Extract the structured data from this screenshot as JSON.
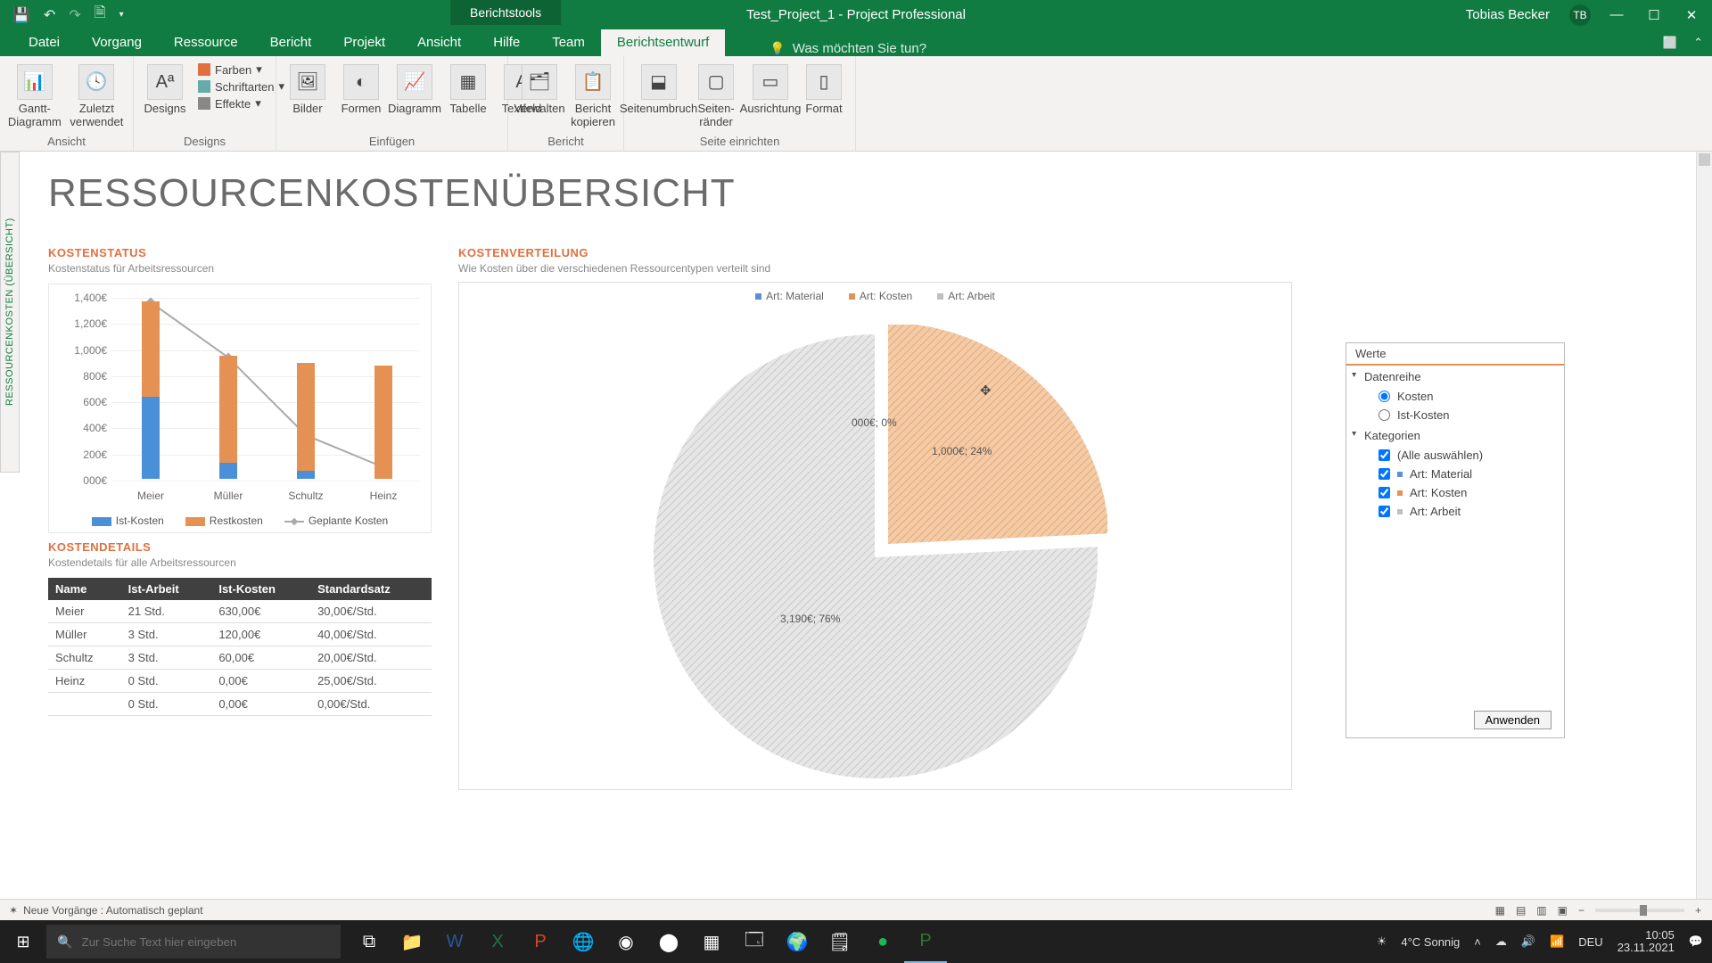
{
  "titlebar": {
    "tool_tab": "Berichtstools",
    "doc_title": "Test_Project_1  -  Project Professional",
    "user_name": "Tobias Becker",
    "user_initials": "TB"
  },
  "tabs": [
    "Datei",
    "Vorgang",
    "Ressource",
    "Bericht",
    "Projekt",
    "Ansicht",
    "Hilfe",
    "Team",
    "Berichtsentwurf"
  ],
  "active_tab": "Berichtsentwurf",
  "tellme": "Was möchten Sie tun?",
  "ribbon": {
    "groups": {
      "ansicht": {
        "label": "Ansicht",
        "gantt": "Gantt-Diagramm",
        "zuletzt": "Zuletzt verwendet"
      },
      "designs": {
        "label": "Designs",
        "designs_btn": "Designs",
        "farben": "Farben",
        "schrift": "Schriftarten",
        "effekte": "Effekte"
      },
      "einfuegen": {
        "label": "Einfügen",
        "bilder": "Bilder",
        "formen": "Formen",
        "diagramm": "Diagramm",
        "tabelle": "Tabelle",
        "textfeld": "Textfeld"
      },
      "bericht": {
        "label": "Bericht",
        "verwalten": "Verwalten",
        "kopieren": "Bericht kopieren"
      },
      "seite": {
        "label": "Seite einrichten",
        "umbruch": "Seitenumbruch",
        "raender": "Seiten-ränder",
        "ausricht": "Ausrichtung",
        "format": "Format"
      }
    }
  },
  "vtab": "RESSOURCENKOSTEN (ÜBERSICHT)",
  "report": {
    "title": "RESSOURCENKOSTENÜBERSICHT",
    "status": {
      "hd": "KOSTENSTATUS",
      "sub": "Kostenstatus für Arbeitsressourcen"
    },
    "vert": {
      "hd": "KOSTENVERTEILUNG",
      "sub": "Wie Kosten über die verschiedenen Ressourcentypen verteilt sind"
    },
    "details": {
      "hd": "KOSTENDETAILS",
      "sub": "Kostendetails für alle Arbeitsressourcen"
    }
  },
  "status_legend": {
    "ist": "Ist-Kosten",
    "rest": "Restkosten",
    "geplant": "Geplante Kosten"
  },
  "pie_legend": {
    "material": "Art: Material",
    "kosten": "Art: Kosten",
    "arbeit": "Art: Arbeit"
  },
  "pie_labels": {
    "material": "000€; 0%",
    "kosten": "1,000€; 24%",
    "arbeit": "3,190€; 76%"
  },
  "combo_ylabels": [
    "000€",
    "200€",
    "400€",
    "600€",
    "800€",
    "1,000€",
    "1,200€",
    "1,400€"
  ],
  "table": {
    "headers": [
      "Name",
      "Ist-Arbeit",
      "Ist-Kosten",
      "Standardsatz"
    ],
    "rows": [
      [
        "Meier",
        "21 Std.",
        "630,00€",
        "30,00€/Std."
      ],
      [
        "Müller",
        "3 Std.",
        "120,00€",
        "40,00€/Std."
      ],
      [
        "Schultz",
        "3 Std.",
        "60,00€",
        "20,00€/Std."
      ],
      [
        "Heinz",
        "0 Std.",
        "0,00€",
        "25,00€/Std."
      ],
      [
        "",
        "0 Std.",
        "0,00€",
        "0,00€/Std."
      ]
    ]
  },
  "werte": {
    "title": "Werte",
    "datenreihe": "Datenreihe",
    "kosten": "Kosten",
    "ist": "Ist-Kosten",
    "kategorien": "Kategorien",
    "alle": "(Alle auswählen)",
    "cat_material": "Art: Material",
    "cat_kosten": "Art: Kosten",
    "cat_arbeit": "Art: Arbeit",
    "apply": "Anwenden"
  },
  "status_text": "Neue Vorgänge : Automatisch geplant",
  "taskbar": {
    "search_placeholder": "Zur Suche Text hier eingeben",
    "weather": "4°C  Sonnig",
    "lang": "DEU",
    "time": "10:05",
    "date": "23.11.2021"
  },
  "chart_data": [
    {
      "type": "bar",
      "name": "Kostenstatus",
      "categories": [
        "Meier",
        "Müller",
        "Schultz",
        "Heinz"
      ],
      "series": [
        {
          "name": "Ist-Kosten",
          "values": [
            630,
            120,
            60,
            0
          ]
        },
        {
          "name": "Restkosten",
          "values": [
            730,
            820,
            830,
            870
          ]
        },
        {
          "name": "Geplante Kosten",
          "values": [
            1360,
            940,
            350,
            100
          ]
        }
      ],
      "ylabel": "€",
      "ylim": [
        0,
        1400
      ]
    },
    {
      "type": "pie",
      "name": "Kostenverteilung",
      "categories": [
        "Art: Material",
        "Art: Kosten",
        "Art: Arbeit"
      ],
      "values": [
        0,
        1000,
        3190
      ],
      "percentages": [
        0,
        24,
        76
      ]
    }
  ]
}
